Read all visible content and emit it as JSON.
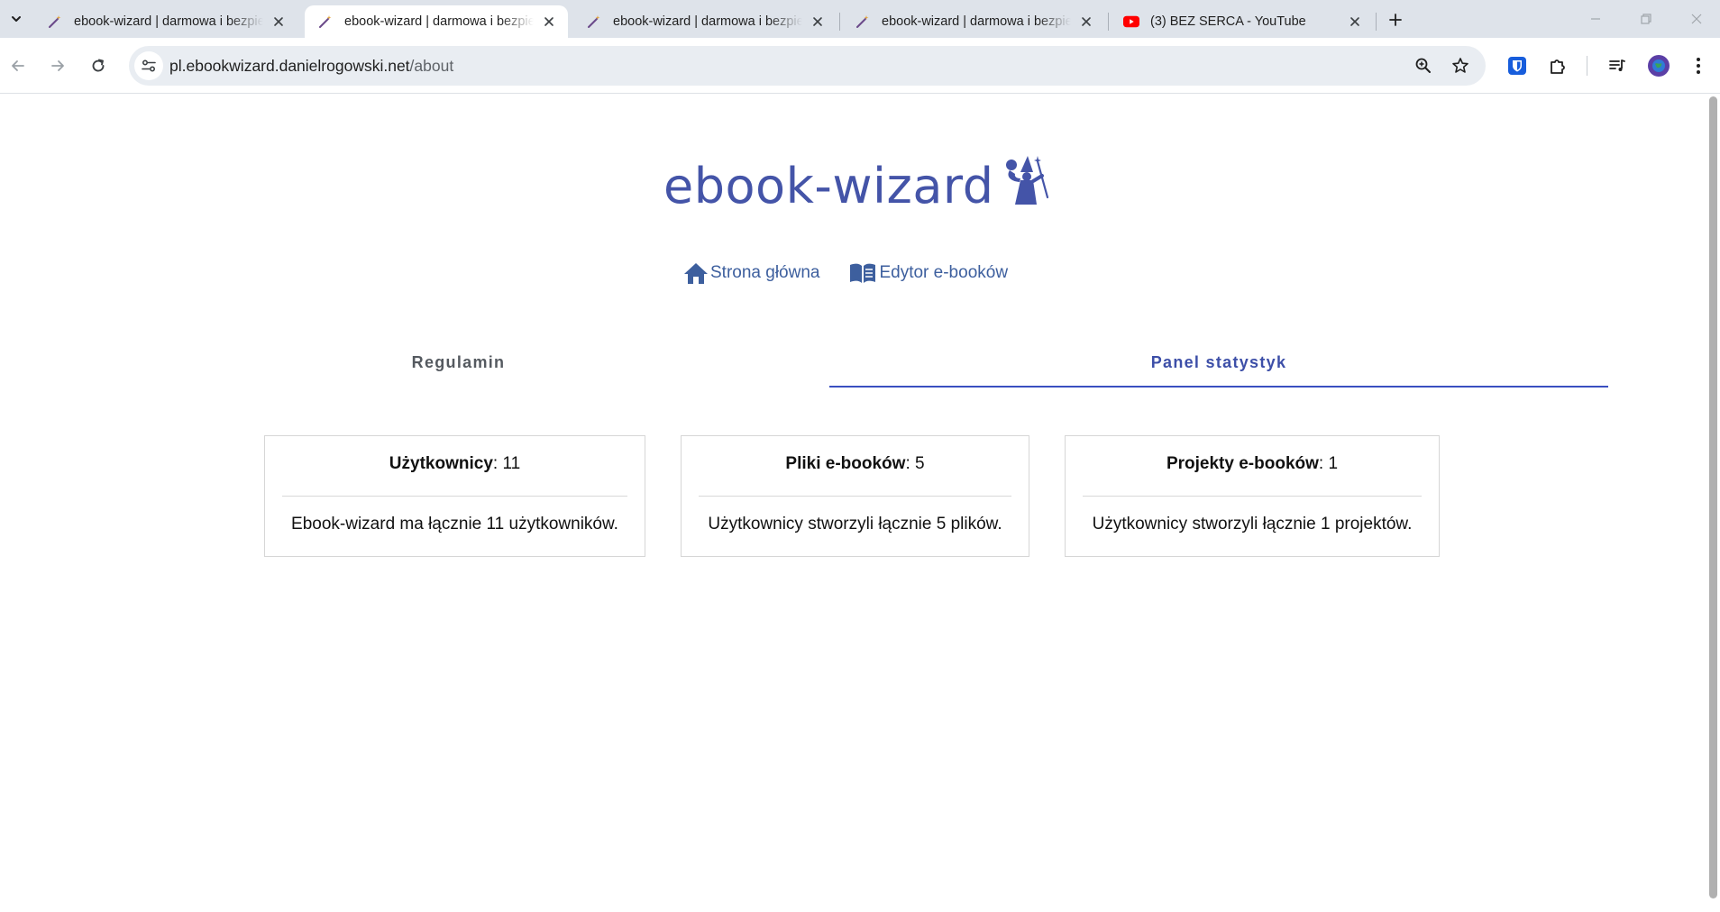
{
  "browser": {
    "tabs": [
      {
        "title": "ebook-wizard | darmowa i bezpieczna",
        "active": false,
        "icon": "wand-icon"
      },
      {
        "title": "ebook-wizard | darmowa i bezpieczna",
        "active": true,
        "icon": "wand-icon"
      },
      {
        "title": "ebook-wizard | darmowa i bezpieczna",
        "active": false,
        "icon": "wand-icon"
      },
      {
        "title": "ebook-wizard | darmowa i bezpieczna",
        "active": false,
        "icon": "wand-icon"
      },
      {
        "title": "(3) BEZ SERCA - YouTube",
        "active": false,
        "icon": "youtube-icon"
      }
    ],
    "url_host": "pl.ebookwizard.danielrogowski.net",
    "url_path": "/about"
  },
  "site": {
    "logo_text": "ebook-wizard",
    "nav": {
      "home": "Strona główna",
      "editor": "Edytor e-booków"
    },
    "tabs": {
      "rules": "Regulamin",
      "stats": "Panel statystyk",
      "active": "stats"
    },
    "stats": [
      {
        "label": "Użytkownicy",
        "value": "11",
        "description": "Ebook-wizard ma łącznie 11 użytkowników."
      },
      {
        "label": "Pliki e-booków",
        "value": "5",
        "description": "Użytkownicy stworzyli łącznie 5 plików."
      },
      {
        "label": "Projekty e-booków",
        "value": "1",
        "description": "Użytkownicy stworzyli łącznie 1 projektów."
      }
    ]
  },
  "colors": {
    "brand": "#4454a8",
    "link": "#3d5f9e",
    "active_tab": "#3d4fa8",
    "tabstrip_bg": "#dee3ea"
  }
}
